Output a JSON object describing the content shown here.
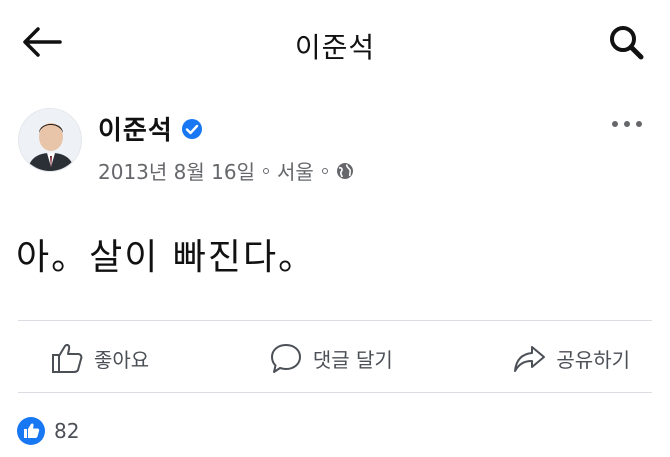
{
  "header": {
    "title": "이준석",
    "back_icon": "arrow-left-icon",
    "search_icon": "search-icon"
  },
  "post": {
    "author": "이준석",
    "verified_icon": "verified-badge-icon",
    "date": "2013년 8월 16일",
    "location": "서울",
    "privacy_icon": "globe-icon",
    "more_icon": "more-horizontal-icon",
    "text": "아。살이 빠진다。"
  },
  "actions": {
    "like": "좋아요",
    "comment": "댓글 달기",
    "share": "공유하기"
  },
  "reactions": {
    "count": "82"
  },
  "colors": {
    "accent": "#1877f2",
    "text": "#1c1e21",
    "secondary": "#65676b",
    "divider": "#dadde1"
  }
}
